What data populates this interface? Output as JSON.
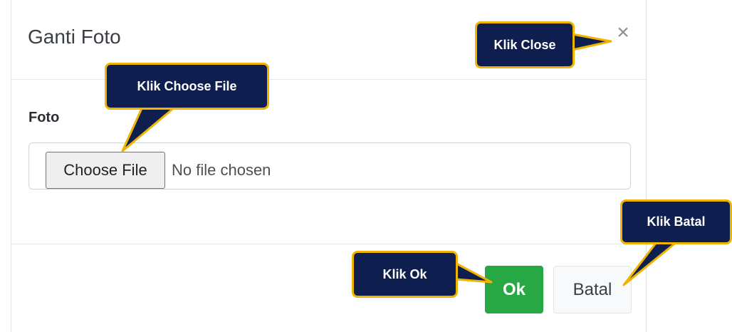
{
  "modal": {
    "title": "Ganti Foto",
    "close_glyph": "×",
    "field_label": "Foto",
    "choose_button_label": "Choose File",
    "file_status": "No file chosen",
    "ok_label": "Ok",
    "cancel_label": "Batal"
  },
  "callouts": {
    "close": "Klik Close",
    "choose_file": "Klik Choose File",
    "ok": "Klik Ok",
    "batal": "Klik Batal"
  },
  "colors": {
    "callout_fill": "#0e1f4f",
    "callout_border": "#f0b400",
    "ok_button": "#28a745"
  }
}
